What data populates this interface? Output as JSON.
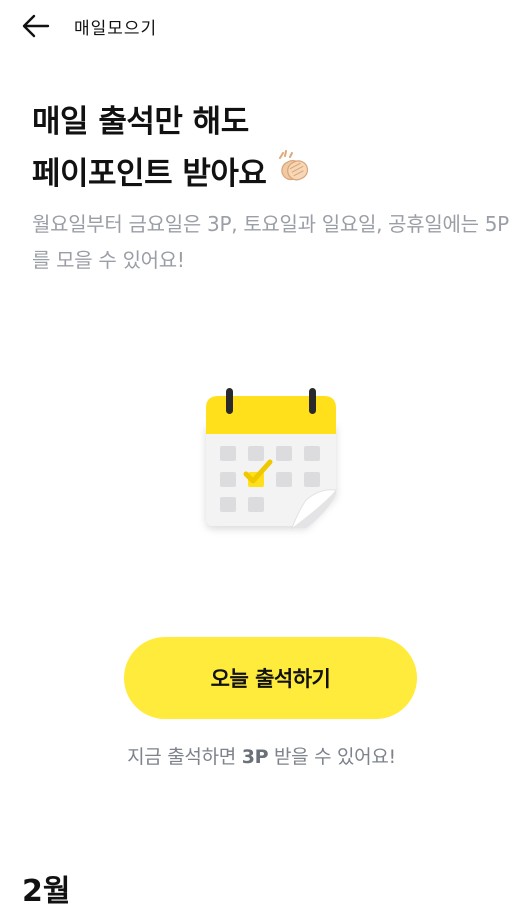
{
  "header": {
    "title": "매일모으기",
    "back_icon": "arrow-left-icon"
  },
  "headline": {
    "line1": "매일 출석만 해도",
    "line2": "페이포인트 받아요",
    "emoji_icon": "clapping-hands-icon"
  },
  "description": "월요일부터 금요일은 3P, 토요일과 일요일, 공휴일에는 5P를 모을 수 있어요!",
  "illustration": {
    "icon": "calendar-check-icon",
    "accent_color": "#FFE01A"
  },
  "cta": {
    "label": "오늘 출석하기",
    "color": "#FFEB3B"
  },
  "hint": {
    "prefix": "지금 출석하면 ",
    "points": "3P",
    "suffix": " 받을 수 있어요!"
  },
  "section": {
    "label": "2월"
  }
}
